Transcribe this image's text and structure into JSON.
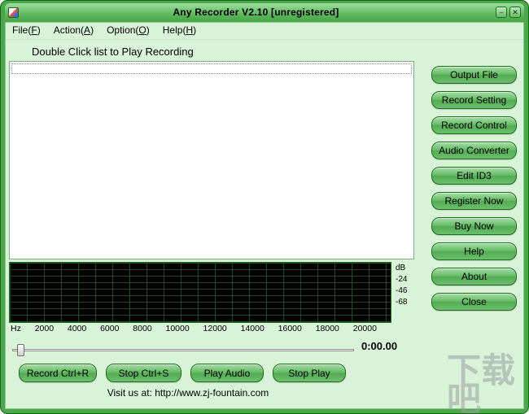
{
  "window": {
    "title": "Any Recorder V2.10  [unregistered]",
    "minimize_glyph": "–",
    "close_glyph": "✕"
  },
  "menu": {
    "items": [
      {
        "name": "File(",
        "key": "F",
        "suffix": ")"
      },
      {
        "name": "Action(",
        "key": "A",
        "suffix": ")"
      },
      {
        "name": "Option(",
        "key": "O",
        "suffix": ")"
      },
      {
        "name": "Help(",
        "key": "H",
        "suffix": ")"
      }
    ]
  },
  "main": {
    "list_label": "Double Click list to Play Recording",
    "time_display": "0:00.00",
    "visit_prefix": "Visit us at: ",
    "visit_url": "http://www.zj-fountain.com"
  },
  "spectrum": {
    "db_labels": [
      "dB",
      "-24",
      "-46",
      "-68"
    ],
    "freq_unit": "Hz",
    "freq_labels": [
      "2000",
      "4000",
      "6000",
      "8000",
      "10000",
      "12000",
      "14000",
      "16000",
      "18000",
      "20000"
    ]
  },
  "sidebar_buttons": [
    "Output File",
    "Record Setting",
    "Record Control",
    "Audio Converter",
    "Edit ID3",
    "Register Now",
    "Buy Now",
    "Help",
    "About",
    "Close"
  ],
  "transport_buttons": [
    "Record Ctrl+R",
    "Stop Ctrl+S",
    "Play Audio",
    "Stop Play"
  ],
  "watermark": {
    "text": "下载吧"
  },
  "colors": {
    "window_green": "#4aa84a",
    "button_green": "#63bb63",
    "background": "#d9f3d9",
    "spectrum_background": "#000000"
  }
}
